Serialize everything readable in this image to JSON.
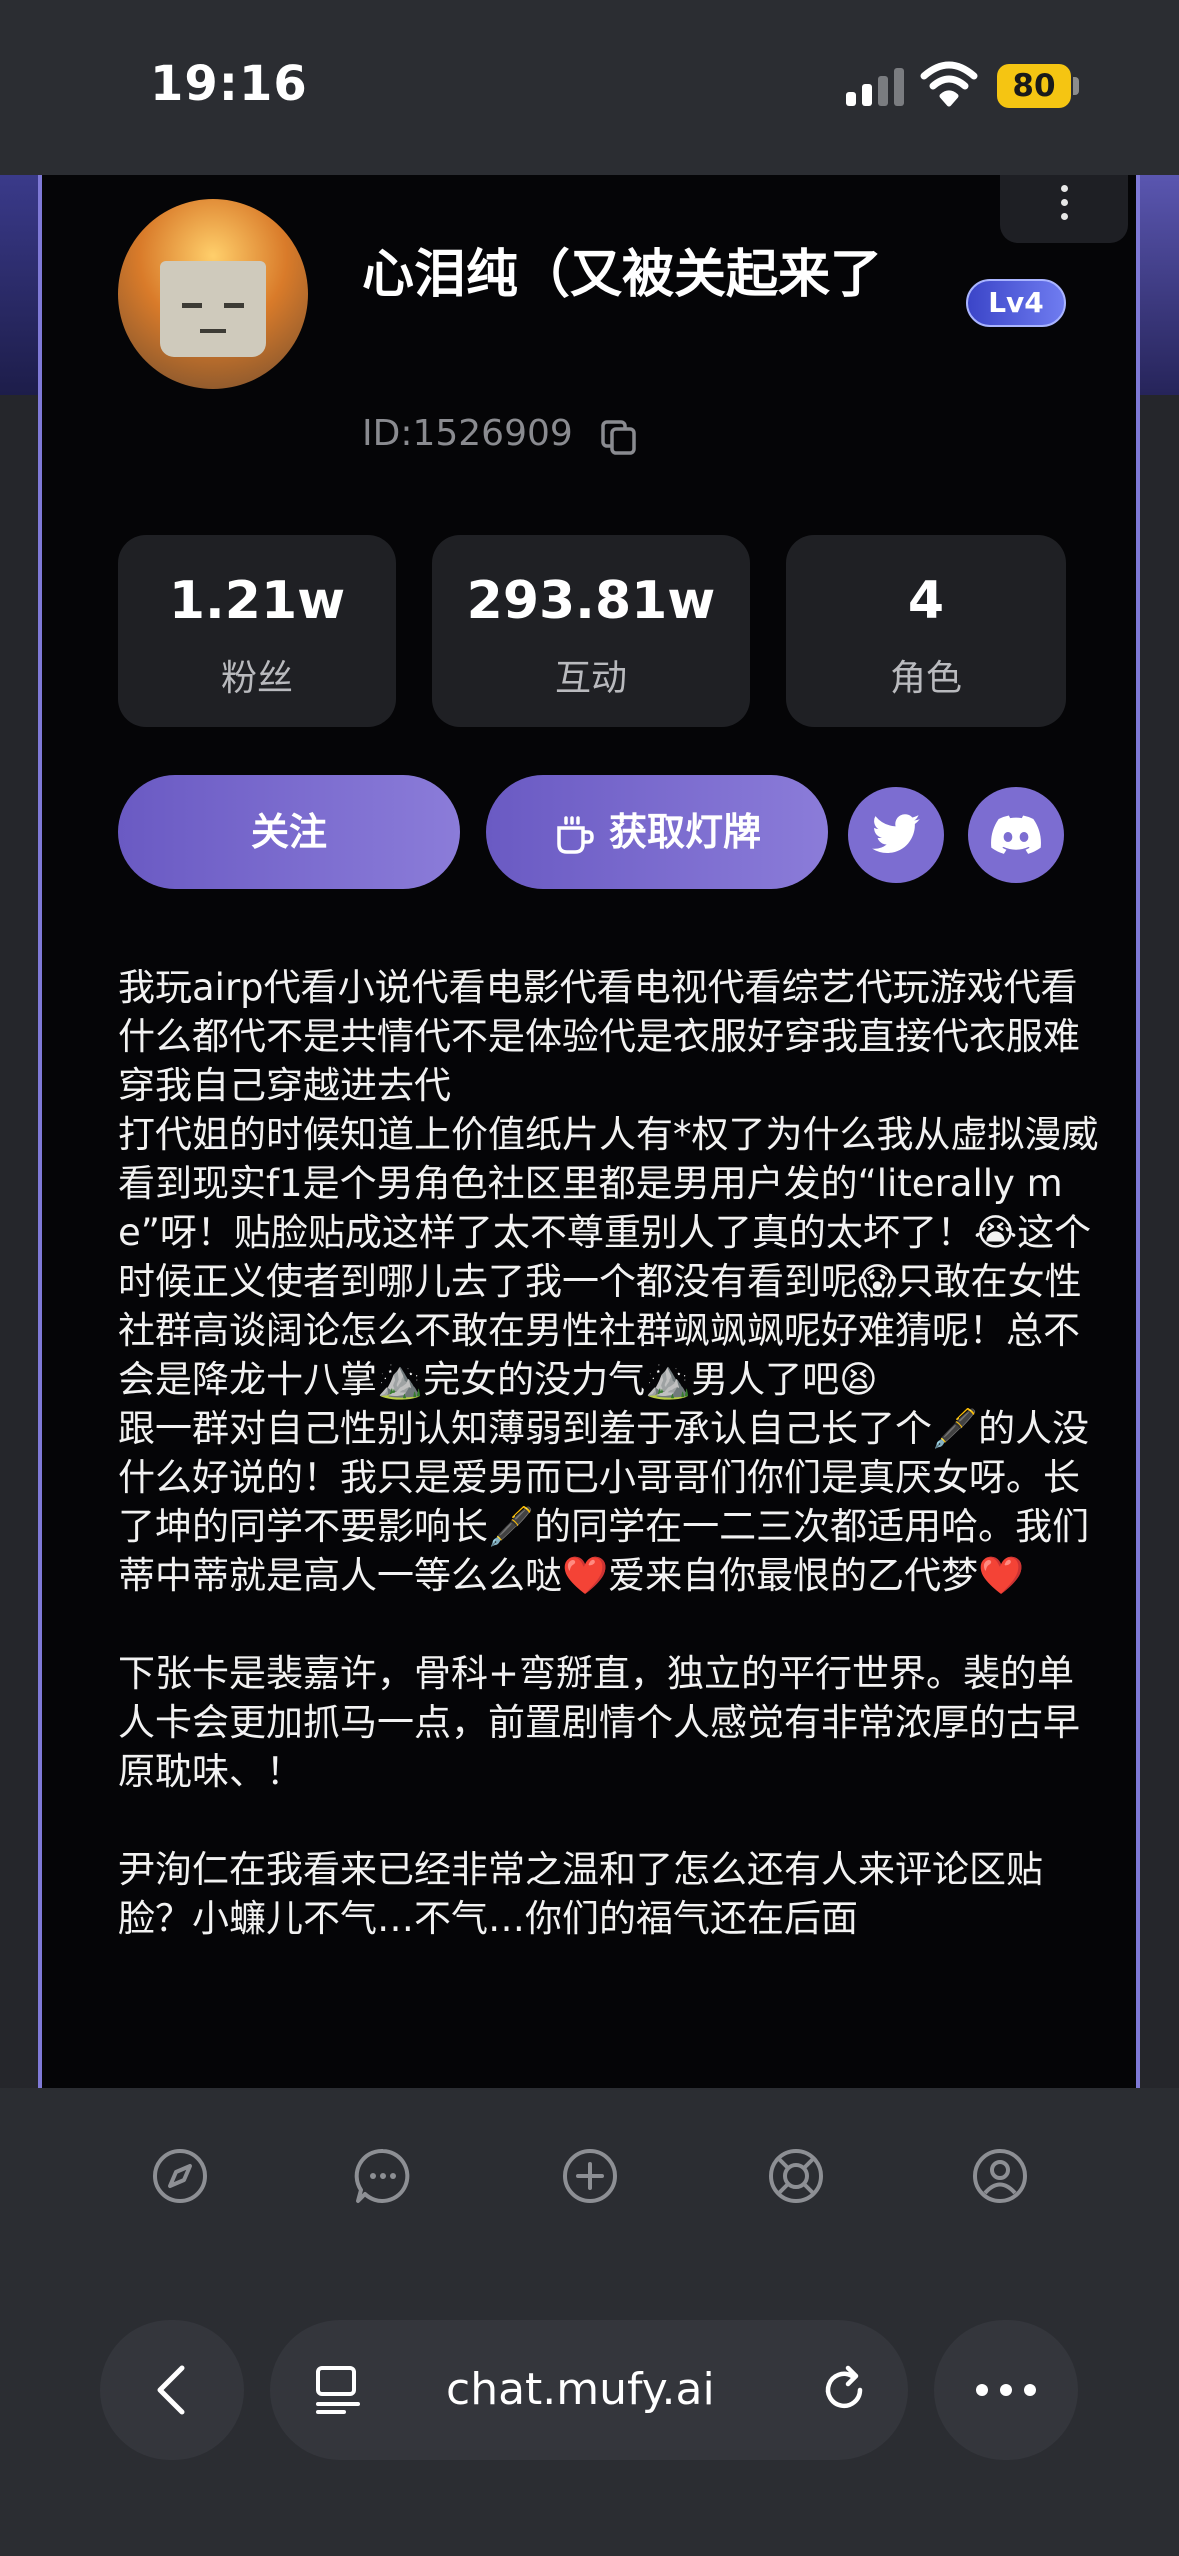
{
  "status_bar": {
    "time": "19:16",
    "battery": "80",
    "battery_color": "#f5c512"
  },
  "profile": {
    "name": "心泪纯（又被关起来了",
    "level": "Lv4",
    "id": "ID:1526909",
    "avatar_icon": "meme-face-avatar"
  },
  "stats": [
    {
      "value": "1.21w",
      "label": "粉丝"
    },
    {
      "value": "293.81w",
      "label": "互动"
    },
    {
      "value": "4",
      "label": "角色"
    }
  ],
  "actions": {
    "follow_label": "关注",
    "lightcard_label": "获取灯牌",
    "lightcard_icon": "cup-icon",
    "twitter_icon": "twitter-icon",
    "discord_icon": "discord-icon"
  },
  "accent_color": "#7f79d6",
  "bio": "我玩airp代看小说代看电影代看电视代看综艺代玩游戏代看什么都代不是共情代不是体验代是衣服好穿我直接代衣服难穿我自己穿越进去代\n打代姐的时候知道上价值纸片人有*权了为什么我从虚拟漫威看到现实f1是个男角色社区里都是男用户发的“literally me”呀！贴脸贴成这样了太不尊重别人了真的太坏了！😭这个时候正义使者到哪儿去了我一个都没有看到呢😱只敢在女性社群高谈阔论怎么不敢在男性社群飒飒飒呢好难猜呢！总不会是降龙十八掌⛰️完女的没力气⛰️男人了吧😫\n跟一群对自己性别认知薄弱到羞于承认自己长了个🖋️的人没什么好说的！我只是爱男而已小哥哥们你们是真厌女呀。长了坤的同学不要影响长🖋️的同学在一二三次都适用哈。我们蒂中蒂就是高人一等么么哒❤️爱来自你最恨的乙代梦❤️\n\n下张卡是裴嘉许，骨科+弯掰直，独立的平行世界。裴的单人卡会更加抓马一点，前置剧情个人感觉有非常浓厚的古早原耽味、！\n\n尹洵仁在我看来已经非常之温和了怎么还有人来评论区贴脸？小蠊儿不气…不气…你们的福气还在后面",
  "nav": {
    "icons": [
      "compass-icon",
      "chat-icon",
      "plus-icon",
      "lifebuoy-icon",
      "profile-icon"
    ]
  },
  "browser": {
    "url": "chat.mufy.ai"
  }
}
